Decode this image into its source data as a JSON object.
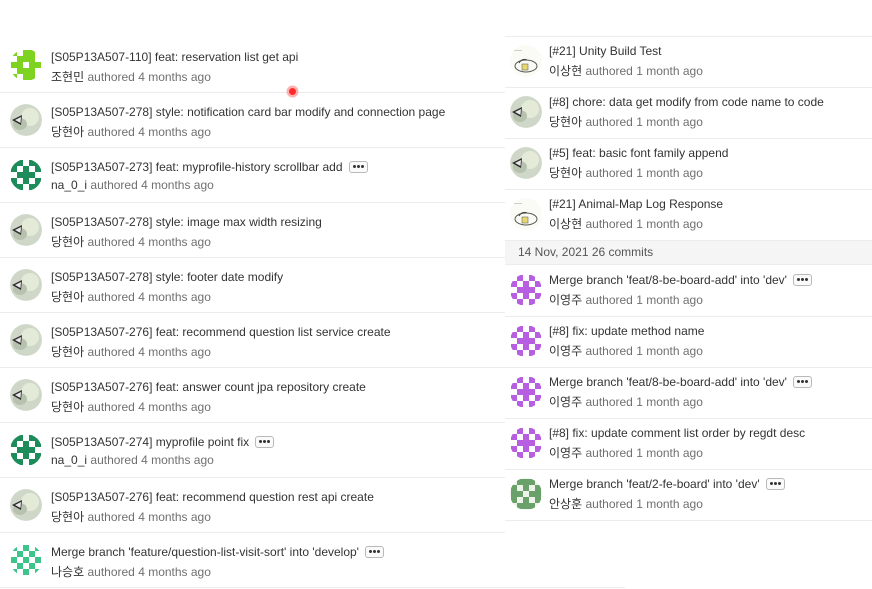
{
  "left_commits": [
    {
      "title": "[S05P13A507-110] feat: reservation list get api",
      "author": "조현민",
      "authored": "authored",
      "time": "4 months ago",
      "avatar": "green-identicon",
      "has_ellipsis": false
    },
    {
      "title": "[S05P13A507-278] style: notification card bar modify and connection page",
      "author": "당현아",
      "authored": "authored",
      "time": "4 months ago",
      "avatar": "photo-avatar",
      "has_ellipsis": false
    },
    {
      "title": "[S05P13A507-273] feat: myprofile-history scrollbar add",
      "author": "na_0_i",
      "authored": "authored",
      "time": "4 months ago",
      "avatar": "teal-identicon",
      "has_ellipsis": true
    },
    {
      "title": "[S05P13A507-278] style: image max width resizing",
      "author": "당현아",
      "authored": "authored",
      "time": "4 months ago",
      "avatar": "photo-avatar",
      "has_ellipsis": false
    },
    {
      "title": "[S05P13A507-278] style: footer date modify",
      "author": "당현아",
      "authored": "authored",
      "time": "4 months ago",
      "avatar": "photo-avatar",
      "has_ellipsis": false
    },
    {
      "title": "[S05P13A507-276] feat: recommend question list service create",
      "author": "당현아",
      "authored": "authored",
      "time": "4 months ago",
      "avatar": "photo-avatar",
      "has_ellipsis": false
    },
    {
      "title": "[S05P13A507-276] feat: answer count jpa repository create",
      "author": "당현아",
      "authored": "authored",
      "time": "4 months ago",
      "avatar": "photo-avatar",
      "has_ellipsis": false
    },
    {
      "title": "[S05P13A507-274] myprofile point fix",
      "author": "na_0_i",
      "authored": "authored",
      "time": "4 months ago",
      "avatar": "teal-identicon",
      "has_ellipsis": true
    },
    {
      "title": "[S05P13A507-276] feat: recommend question rest api create",
      "author": "당현아",
      "authored": "authored",
      "time": "4 months ago",
      "avatar": "photo-avatar",
      "has_ellipsis": false
    },
    {
      "title": "Merge branch 'feature/question-list-visit-sort' into 'develop'",
      "author": "나승호",
      "authored": "authored",
      "time": "4 months ago",
      "avatar": "mint-identicon",
      "has_ellipsis": true
    }
  ],
  "right_commits_top": [
    {
      "title": "[#21] Unity Build Test",
      "author": "이상현",
      "authored": "authored",
      "time": "1 month ago",
      "avatar": "sketch-avatar",
      "has_ellipsis": false
    },
    {
      "title": "[#8] chore: data get modify from code name to code",
      "author": "당현아",
      "authored": "authored",
      "time": "1 month ago",
      "avatar": "photo-avatar",
      "has_ellipsis": false
    },
    {
      "title": "[#5] feat: basic font family append",
      "author": "당현아",
      "authored": "authored",
      "time": "1 month ago",
      "avatar": "photo-avatar",
      "has_ellipsis": false
    },
    {
      "title": "[#21] Animal-Map Log Response",
      "author": "이상현",
      "authored": "authored",
      "time": "1 month ago",
      "avatar": "sketch-avatar",
      "has_ellipsis": false
    }
  ],
  "date_header": "14 Nov, 2021 26 commits",
  "right_commits_bottom": [
    {
      "title": "Merge branch 'feat/8-be-board-add' into 'dev'",
      "author": "이영주",
      "authored": "authored",
      "time": "1 month ago",
      "avatar": "purple-identicon",
      "has_ellipsis": true
    },
    {
      "title": "[#8] fix: update method name",
      "author": "이영주",
      "authored": "authored",
      "time": "1 month ago",
      "avatar": "purple-identicon",
      "has_ellipsis": false
    },
    {
      "title": "Merge branch 'feat/8-be-board-add' into 'dev'",
      "author": "이영주",
      "authored": "authored",
      "time": "1 month ago",
      "avatar": "purple-identicon",
      "has_ellipsis": true
    },
    {
      "title": "[#8] fix: update comment list order by regdt desc",
      "author": "이영주",
      "authored": "authored",
      "time": "1 month ago",
      "avatar": "purple-identicon",
      "has_ellipsis": false
    },
    {
      "title": "Merge branch 'feat/2-fe-board' into 'dev'",
      "author": "안상훈",
      "authored": "authored",
      "time": "1 month ago",
      "avatar": "olive-identicon",
      "has_ellipsis": true
    }
  ],
  "colors": {
    "green_identicon": "#7ed321",
    "teal_identicon": "#1e8c5a",
    "mint_identicon": "#3cc48a",
    "purple_identicon": "#b85ee0",
    "olive_identicon": "#6aa16a"
  }
}
